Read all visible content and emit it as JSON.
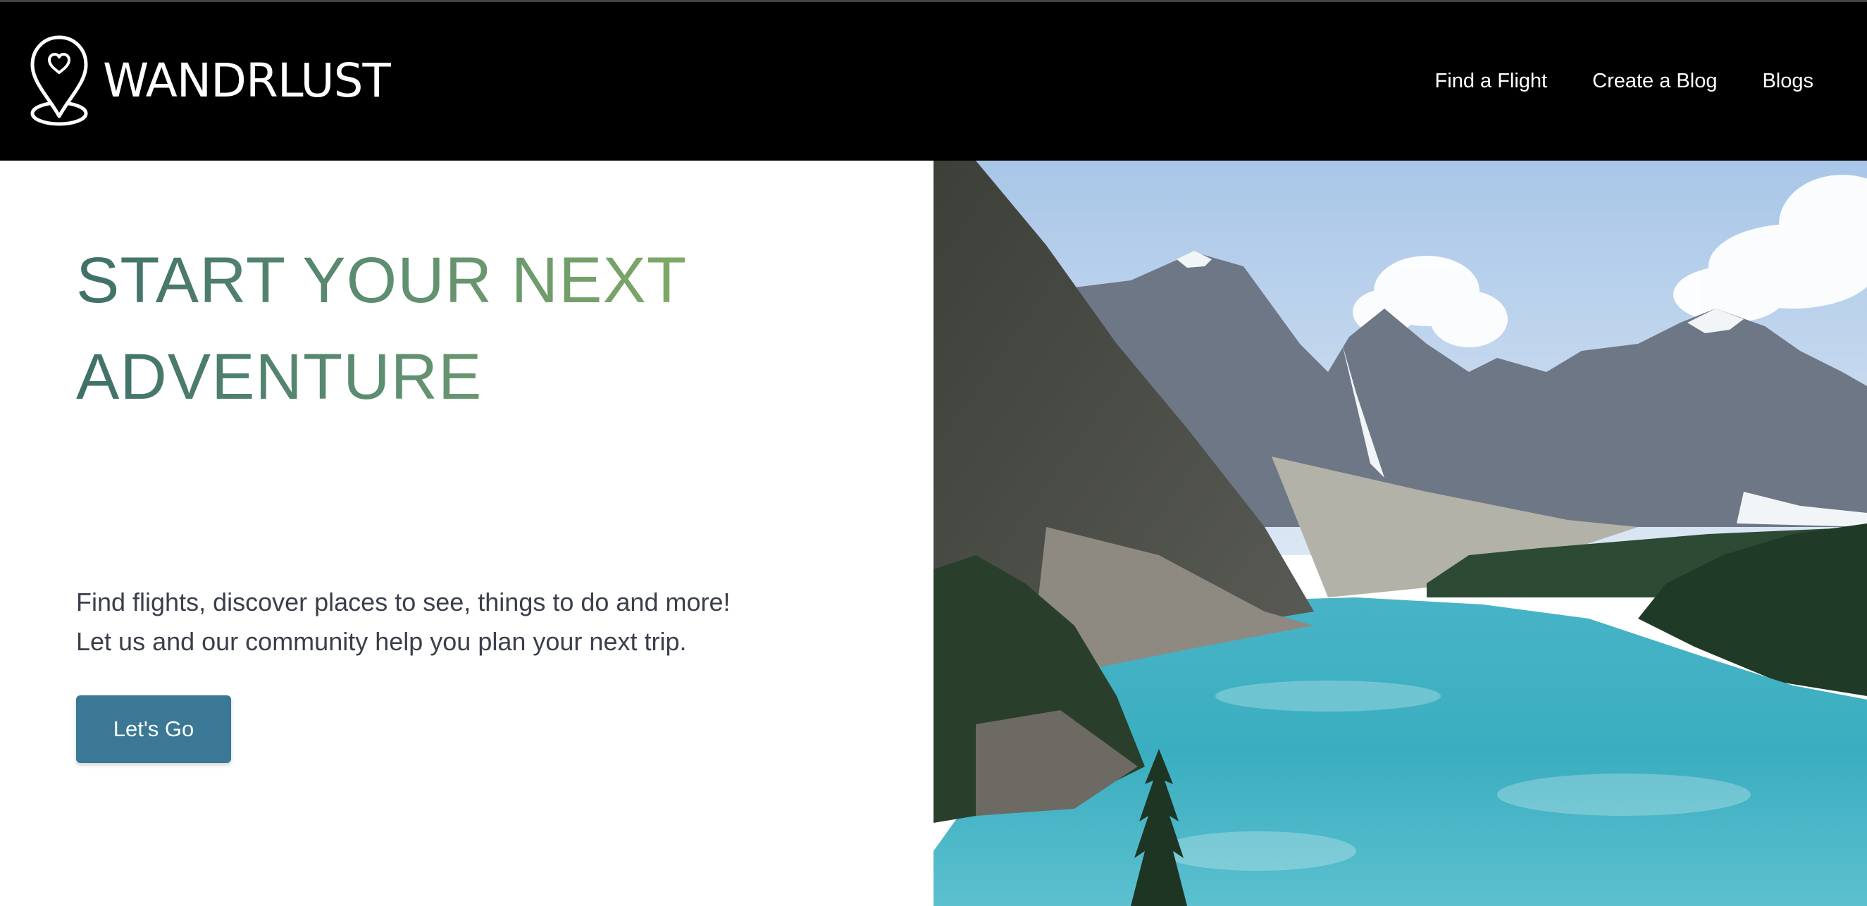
{
  "brand": {
    "name": "WANDRLUST",
    "logo_icon": "map-pin-heart-icon"
  },
  "nav": {
    "items": [
      {
        "label": "Find a Flight"
      },
      {
        "label": "Create a Blog"
      },
      {
        "label": "Blogs"
      }
    ]
  },
  "hero": {
    "title_line1": "START YOUR NEXT",
    "title_line2": "ADVENTURE",
    "text_line1": "Find flights, discover places to see, things to do and more!",
    "text_line2": "Let us and our community help you plan your next trip.",
    "cta_label": "Let's Go",
    "image_subject": "mountain-lake-landscape"
  },
  "colors": {
    "navbar_bg": "#000000",
    "title_gradient_start": "#3f7069",
    "title_gradient_end": "#7ea866",
    "cta_bg": "#3a7896",
    "body_text": "#3a3f4a",
    "lake": "#3fb3c4"
  }
}
